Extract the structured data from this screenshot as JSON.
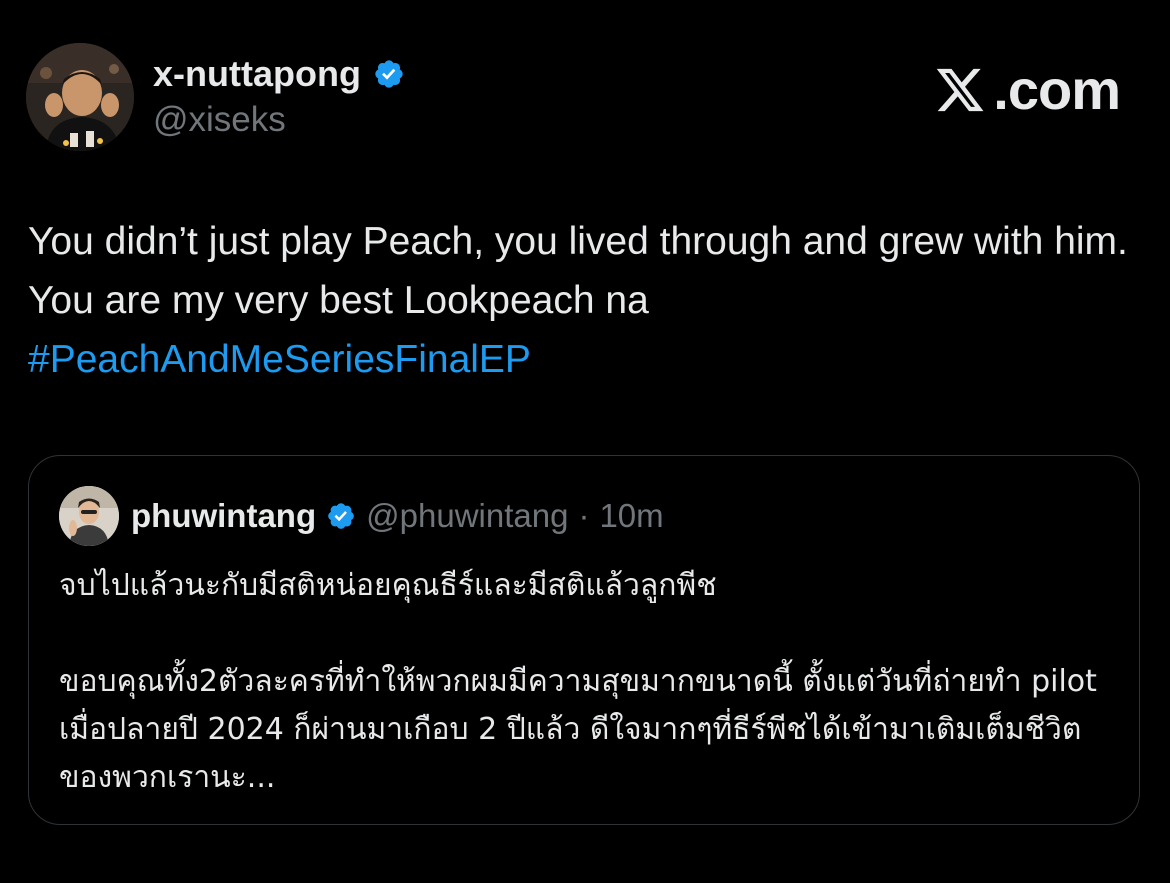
{
  "author": {
    "display_name": "x-nuttapong",
    "handle": "@xiseks",
    "avatar_icon": "avatar-photo",
    "verified_icon": "verified-badge-icon"
  },
  "brand": {
    "icon": "x-logo-icon",
    "text": ".com"
  },
  "tweet": {
    "text": "You didn’t just play Peach, you lived through and grew with him. You are my very best Lookpeach na",
    "hashtag": "#PeachAndMeSeriesFinalEP"
  },
  "quote": {
    "display_name": "phuwintang",
    "handle": "@phuwintang",
    "separator": "·",
    "time": "10m",
    "paragraph_1": "จบไปแล้วนะกับมีสติหน่อยคุณธีร์และมีสติแล้วลูกพีช",
    "paragraph_2": "ขอบคุณทั้ง2ตัวละครที่ทำให้พวกผมมีความสุขมากขนาดนี้ ตั้งแต่วันที่ถ่ายทำ pilot เมื่อปลายปี 2024 ก็ผ่านมาเกือบ 2 ปีแล้ว ดีใจมากๆที่ธีร์พีชได้เข้ามาเติมเต็มชีวิตของพวกเรานะ..."
  },
  "colors": {
    "background": "#000000",
    "text_primary": "#e7e9ea",
    "text_secondary": "#71767b",
    "accent_link": "#1d9bf0",
    "border": "#2f3336"
  }
}
